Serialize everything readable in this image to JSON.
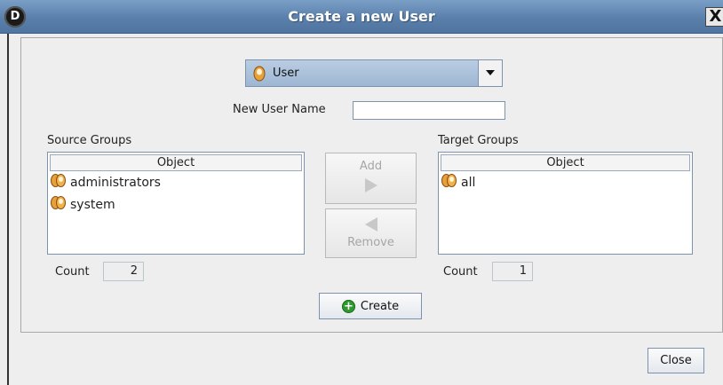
{
  "window": {
    "title": "Create a new User",
    "logo_letter": "D",
    "close_glyph": "X"
  },
  "type_selector": {
    "selected": "User",
    "icon": "user-icon"
  },
  "name_field": {
    "label": "New User Name",
    "value": ""
  },
  "source": {
    "title": "Source Groups",
    "column": "Object",
    "items": [
      {
        "label": "administrators",
        "icon": "group-icon"
      },
      {
        "label": "system",
        "icon": "group-icon"
      }
    ],
    "count_label": "Count",
    "count": "2"
  },
  "target": {
    "title": "Target Groups",
    "column": "Object",
    "items": [
      {
        "label": "all",
        "icon": "group-icon"
      }
    ],
    "count_label": "Count",
    "count": "1"
  },
  "actions": {
    "add": "Add",
    "remove": "Remove",
    "create": "Create",
    "close": "Close"
  },
  "colors": {
    "title_bar": "#5a7fab",
    "selector": "#a9bfd9",
    "create_icon": "#2e9a2e",
    "group_icon": "#e8a13a"
  }
}
